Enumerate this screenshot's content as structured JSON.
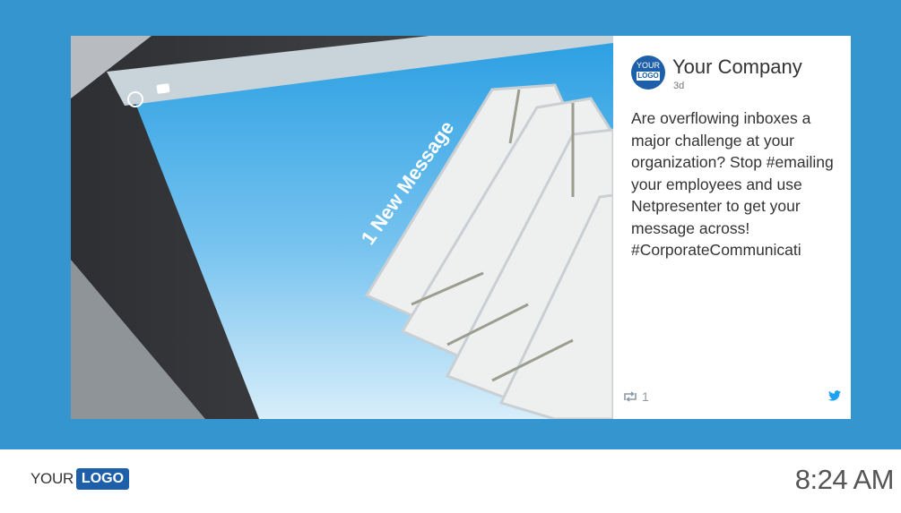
{
  "post": {
    "author": "Your Company",
    "age": "3d",
    "avatar_text_top": "YOUR",
    "avatar_text_bottom": "LOGO",
    "text": "Are overflowing inboxes a major challenge at your organization? Stop #emailing your employees and use Netpresenter to get your message across! #CorporateCommunicati",
    "retweet_count": "1"
  },
  "image": {
    "caption": "1 New Message"
  },
  "footer": {
    "logo_your": "YOUR",
    "logo_logo": "LOGO",
    "time": "8:24 AM"
  },
  "colors": {
    "background": "#3596cf",
    "brand": "#1d5fa8",
    "twitter": "#1da1f2"
  }
}
